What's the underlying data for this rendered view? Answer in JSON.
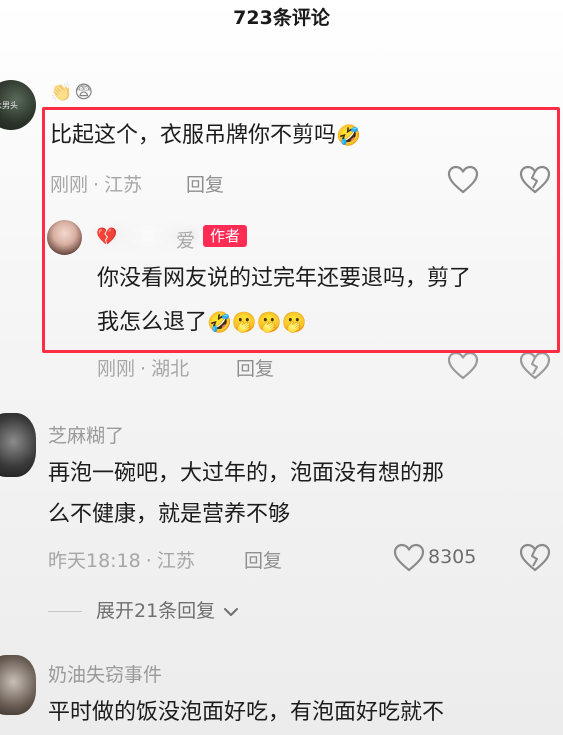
{
  "header": {
    "title": "723条评论"
  },
  "comments": [
    {
      "avatar_text": "众男头",
      "reactions": "👏😨",
      "text": "比起这个，衣服吊牌你不剪吗",
      "emoji": "🤣",
      "time": "刚刚",
      "location": "江苏",
      "reply_label": "回复",
      "reply": {
        "name_tail": "爱",
        "badge": "作者",
        "line1": "你没看网友说的过完年还要退吗，剪了",
        "line2": "我怎么退了",
        "emojis": "🤣🫢🫢🫢",
        "time": "刚刚",
        "location": "湖北",
        "reply_label": "回复"
      }
    },
    {
      "username": "芝麻糊了",
      "line1": "再泡一碗吧，大过年的，泡面没有想的那",
      "line2": "么不健康，就是营养不够",
      "time": "昨天18:18",
      "location": "江苏",
      "reply_label": "回复",
      "likes": "8305",
      "expand_label": "展开21条回复"
    },
    {
      "username": "奶油失窃事件",
      "line1": "平时做的饭没泡面好吃，有泡面好吃就不"
    }
  ],
  "icons": {
    "like": "heart-outline-icon",
    "dislike": "broken-heart-icon",
    "chevron": "chevron-down-icon"
  },
  "colors": {
    "highlight": "#ff2d43",
    "author_badge": "#fe2c55"
  }
}
